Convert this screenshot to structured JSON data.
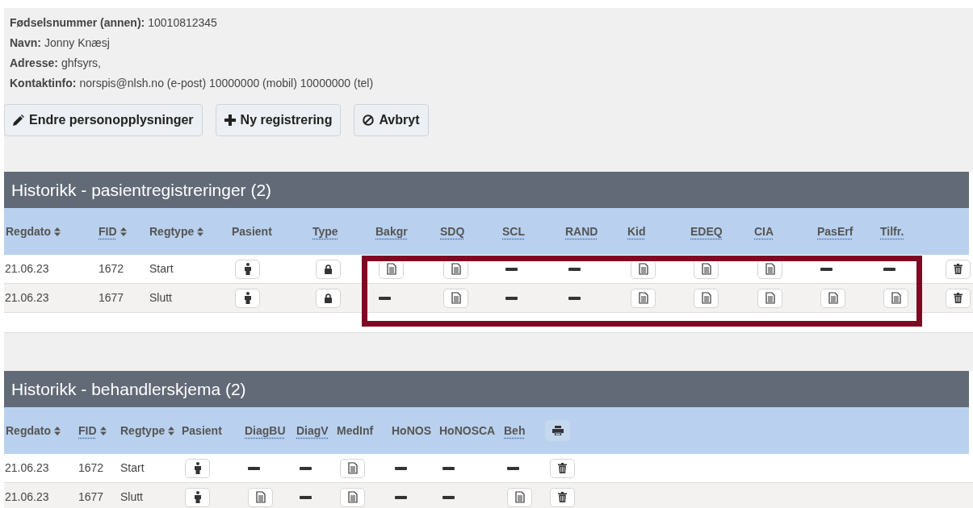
{
  "person": [
    {
      "label": "Fødselsnummer (annen):",
      "value": "10010812345"
    },
    {
      "label": "Navn:",
      "value": "Jonny Knæsj"
    },
    {
      "label": "Adresse:",
      "value": "ghfsyrs,"
    },
    {
      "label": "Kontaktinfo:",
      "value": "norspis@nlsh.no (e-post) 10000000 (mobil) 10000000 (tel)"
    }
  ],
  "buttons": [
    {
      "kind": "pencil",
      "label": "Endre personopplysninger"
    },
    {
      "kind": "plus",
      "label": "Ny registrering"
    },
    {
      "kind": "cancel",
      "label": "Avbryt"
    }
  ],
  "tables": [
    {
      "title": "Historikk - pasientregistreringer (2)",
      "annotated": true,
      "columns": [
        {
          "kind": "text",
          "label": "Regdato",
          "sortable": true,
          "dotted": false
        },
        {
          "kind": "text",
          "label": "FID",
          "sortable": true,
          "dotted": true
        },
        {
          "kind": "text",
          "label": "Regtype",
          "sortable": true,
          "dotted": false
        },
        {
          "kind": "text",
          "label": "Pasient",
          "sortable": false,
          "dotted": false
        },
        {
          "kind": "text",
          "label": "Type",
          "sortable": false,
          "dotted": true
        },
        {
          "kind": "text",
          "label": "Bakgr",
          "sortable": false,
          "dotted": true
        },
        {
          "kind": "text",
          "label": "SDQ",
          "sortable": false,
          "dotted": true
        },
        {
          "kind": "text",
          "label": "SCL",
          "sortable": false,
          "dotted": true
        },
        {
          "kind": "text",
          "label": "RAND",
          "sortable": false,
          "dotted": true
        },
        {
          "kind": "text",
          "label": "Kid",
          "sortable": false,
          "dotted": true
        },
        {
          "kind": "text",
          "label": "EDEQ",
          "sortable": false,
          "dotted": true
        },
        {
          "kind": "text",
          "label": "CIA",
          "sortable": false,
          "dotted": true
        },
        {
          "kind": "text",
          "label": "PasErf",
          "sortable": false,
          "dotted": true
        },
        {
          "kind": "text",
          "label": "Tilfr.",
          "sortable": false,
          "dotted": true
        },
        {
          "kind": "empty"
        }
      ],
      "rows": [
        {
          "regdato": "21.06.23",
          "fid": "1672",
          "regtype": "Start",
          "cells": [
            {
              "kind": "person"
            },
            {
              "kind": "lock"
            },
            {
              "kind": "doc"
            },
            {
              "kind": "doc"
            },
            {
              "kind": "dash"
            },
            {
              "kind": "dash"
            },
            {
              "kind": "doc"
            },
            {
              "kind": "doc"
            },
            {
              "kind": "doc"
            },
            {
              "kind": "dash"
            },
            {
              "kind": "dash"
            },
            {
              "kind": "trash"
            }
          ]
        },
        {
          "regdato": "21.06.23",
          "fid": "1677",
          "regtype": "Slutt",
          "cells": [
            {
              "kind": "person"
            },
            {
              "kind": "lock"
            },
            {
              "kind": "dash"
            },
            {
              "kind": "doc"
            },
            {
              "kind": "dash"
            },
            {
              "kind": "dash"
            },
            {
              "kind": "doc"
            },
            {
              "kind": "doc"
            },
            {
              "kind": "doc"
            },
            {
              "kind": "doc"
            },
            {
              "kind": "doc"
            },
            {
              "kind": "trash"
            }
          ]
        }
      ]
    },
    {
      "title": "Historikk - behandlerskjema (2)",
      "columns": [
        {
          "kind": "text",
          "label": "Regdato",
          "sortable": true,
          "dotted": false
        },
        {
          "kind": "text",
          "label": "FID",
          "sortable": true,
          "dotted": true
        },
        {
          "kind": "text",
          "label": "Regtype",
          "sortable": true,
          "dotted": false
        },
        {
          "kind": "text",
          "label": "Pasient",
          "sortable": false,
          "dotted": false
        },
        {
          "kind": "text",
          "label": "DiagBU",
          "sortable": false,
          "dotted": true
        },
        {
          "kind": "text",
          "label": "DiagV",
          "sortable": false,
          "dotted": true
        },
        {
          "kind": "text",
          "label": "MedInf",
          "sortable": false,
          "dotted": false
        },
        {
          "kind": "text",
          "label": "HoNOS",
          "sortable": false,
          "dotted": false
        },
        {
          "kind": "text",
          "label": "HoNOSCA",
          "sortable": false,
          "dotted": false
        },
        {
          "kind": "text",
          "label": "Beh",
          "sortable": false,
          "dotted": true
        },
        {
          "kind": "print"
        }
      ],
      "rows": [
        {
          "regdato": "21.06.23",
          "fid": "1672",
          "regtype": "Start",
          "cells": [
            {
              "kind": "person"
            },
            {
              "kind": "dash"
            },
            {
              "kind": "dash"
            },
            {
              "kind": "doc"
            },
            {
              "kind": "dash"
            },
            {
              "kind": "dash"
            },
            {
              "kind": "dash"
            },
            {
              "kind": "trash"
            }
          ]
        },
        {
          "regdato": "21.06.23",
          "fid": "1677",
          "regtype": "Slutt",
          "cells": [
            {
              "kind": "person"
            },
            {
              "kind": "doc"
            },
            {
              "kind": "dash"
            },
            {
              "kind": "doc"
            },
            {
              "kind": "dash"
            },
            {
              "kind": "dash"
            },
            {
              "kind": "doc"
            },
            {
              "kind": "trash"
            }
          ]
        }
      ]
    }
  ]
}
